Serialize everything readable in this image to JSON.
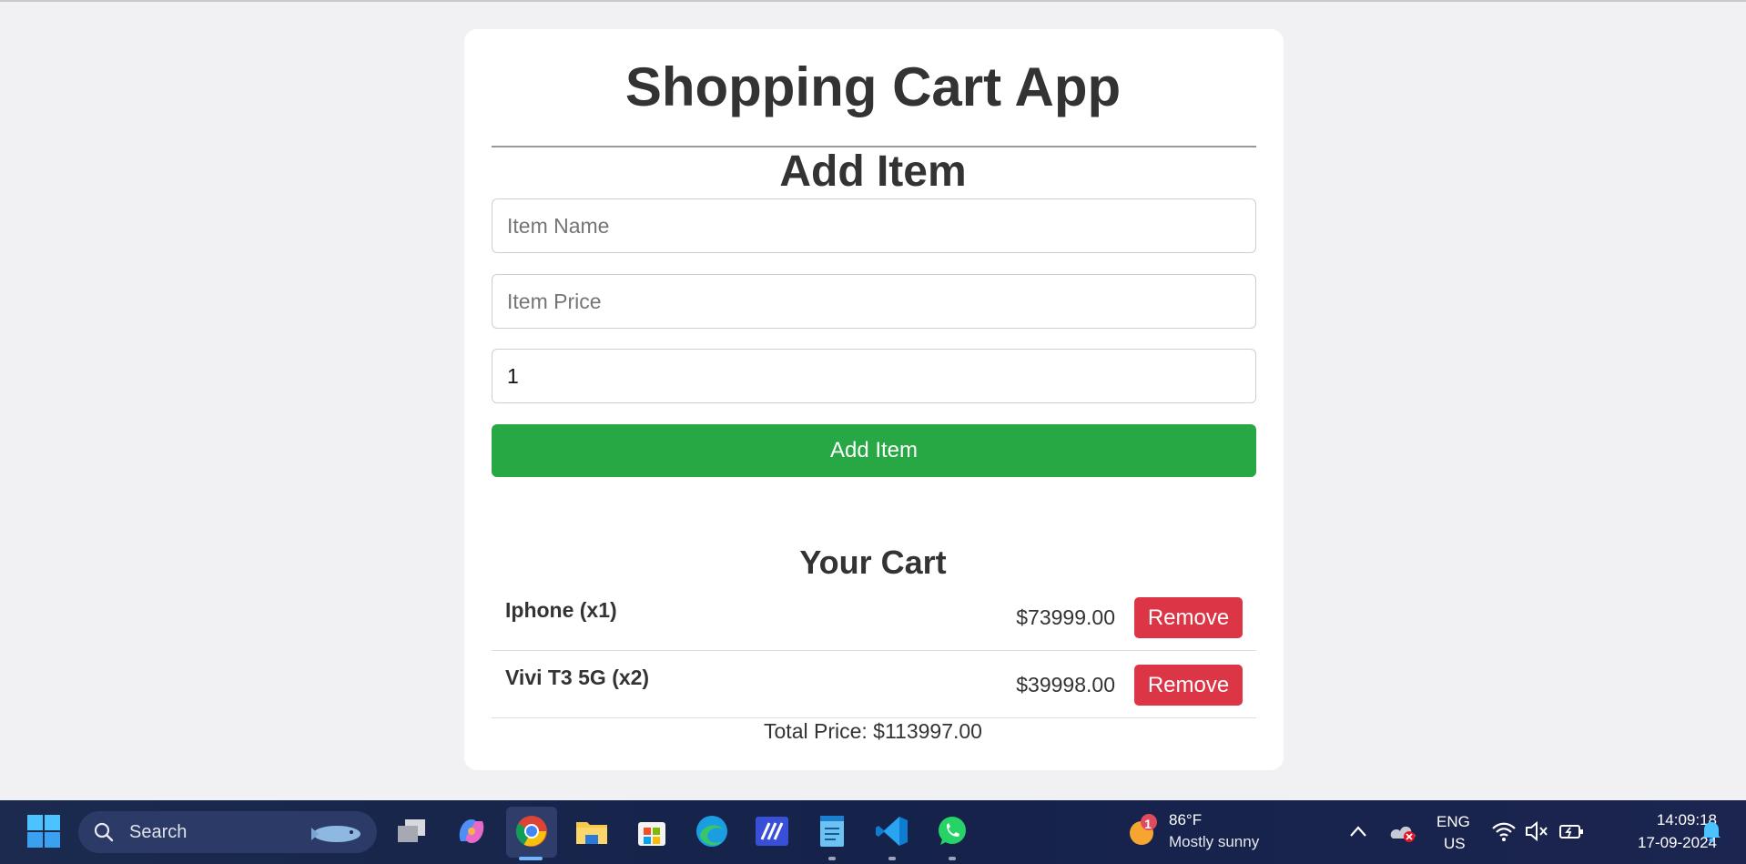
{
  "app": {
    "title": "Shopping Cart App"
  },
  "add_section": {
    "title": "Add Item",
    "name_placeholder": "Item Name",
    "price_placeholder": "Item Price",
    "quantity_value": "1",
    "add_button_label": "Add Item"
  },
  "cart": {
    "title": "Your Cart",
    "items": [
      {
        "label": "Iphone (x1)",
        "price": "$73999.00",
        "remove_label": "Remove"
      },
      {
        "label": "Vivi T3 5G (x2)",
        "price": "$39998.00",
        "remove_label": "Remove"
      }
    ],
    "total": "Total Price: $113997.00"
  },
  "taskbar": {
    "search_label": "Search",
    "weather_badge": "1",
    "weather_temp": "86°F",
    "weather_desc": "Mostly sunny",
    "lang_line1": "ENG",
    "lang_line2": "US",
    "time": "14:09:18",
    "date": "17-09-2024",
    "icons": [
      "windows-start-icon",
      "search-icon",
      "task-view-icon",
      "copilot-icon",
      "chrome-icon",
      "file-explorer-icon",
      "store-icon",
      "edge-icon",
      "app-icon",
      "notepad-icon",
      "vscode-icon",
      "whatsapp-icon",
      "chevron-up-icon",
      "onedrive-icon",
      "wifi-icon",
      "volume-muted-icon",
      "battery-icon",
      "notification-bell-icon"
    ]
  },
  "colors": {
    "add_button": "#28a745",
    "remove_button": "#dc3545",
    "taskbar": "#1b2a4e"
  }
}
